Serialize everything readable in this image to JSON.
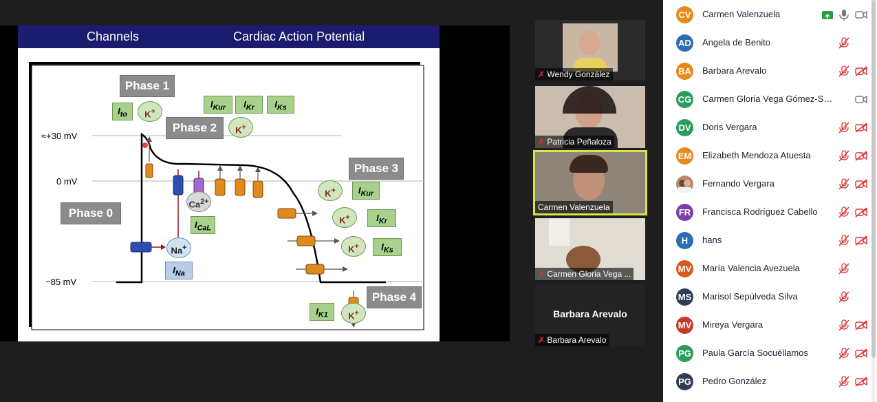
{
  "slide": {
    "header_left": "Channels",
    "header_right": "Cardiac Action Potential",
    "phases": [
      "Phase 0",
      "Phase 1",
      "Phase 2",
      "Phase 3",
      "Phase 4"
    ],
    "voltages": [
      "≈+30 mV",
      "0 mV",
      "−85 mV"
    ],
    "ion_k": "K",
    "ion_k_sup": "+",
    "ion_ca": "Ca",
    "ion_ca_sup": "2+",
    "ion_na": "Na",
    "ion_na_sup": "+",
    "cur_main": "I",
    "currents": {
      "ito": "to",
      "ikur": "Kur",
      "ikr": "Kr",
      "iks": "Ks",
      "ical": "CaL",
      "ina": "Na",
      "ik1": "K1"
    }
  },
  "videos": [
    {
      "name": "Wendy González",
      "muted": true
    },
    {
      "name": "Patricia Peñaloza",
      "muted": true
    },
    {
      "name": "Carmen Valenzuela",
      "muted": false,
      "active": true
    },
    {
      "name": "Carmen Gloria Vega ...",
      "muted": true
    },
    {
      "name": "Barbara Arevalo",
      "muted": true,
      "big_name": "Barbara Arevalo"
    }
  ],
  "participants": [
    {
      "initials": "CV",
      "name": "Carmen Valenzuela",
      "color": "#e8891c",
      "mic": "on",
      "video": "on",
      "share": true
    },
    {
      "initials": "AD",
      "name": "Angela de Benito",
      "color": "#2d6db5",
      "mic": "off",
      "video": "none"
    },
    {
      "initials": "BA",
      "name": "Barbara Arevalo",
      "color": "#e8891c",
      "mic": "off",
      "video": "off"
    },
    {
      "initials": "CG",
      "name": "Carmen Gloria Vega Gómez-SR...",
      "color": "#2a9d5c",
      "mic": "none",
      "video": "on"
    },
    {
      "initials": "DV",
      "name": "Doris Vergara",
      "color": "#2a9d5c",
      "mic": "off",
      "video": "off"
    },
    {
      "initials": "EM",
      "name": "Elizabeth Mendoza Atuesta",
      "color": "#e8891c",
      "mic": "off",
      "video": "off"
    },
    {
      "initials": "",
      "name": "Fernando Vergara",
      "color": "#b98a6e",
      "mic": "off",
      "video": "off",
      "photo": true
    },
    {
      "initials": "FR",
      "name": "Francisca Rodríguez Cabello",
      "color": "#7b3fa8",
      "mic": "off",
      "video": "off"
    },
    {
      "initials": "H",
      "name": "hans",
      "color": "#2d6db5",
      "mic": "off",
      "video": "off"
    },
    {
      "initials": "MV",
      "name": "María Valencia Avezuela",
      "color": "#d9581c",
      "mic": "off",
      "video": "none"
    },
    {
      "initials": "MS",
      "name": "Marisol Sepúlveda Silva",
      "color": "#2f3e55",
      "mic": "off",
      "video": "none"
    },
    {
      "initials": "MV",
      "name": "Mireya Vergara",
      "color": "#c43b2c",
      "mic": "off",
      "video": "off"
    },
    {
      "initials": "PG",
      "name": "Paula García Socuéllamos",
      "color": "#2a9d5c",
      "mic": "off",
      "video": "off"
    },
    {
      "initials": "PG",
      "name": "Pedro González",
      "color": "#2f3e55",
      "mic": "off",
      "video": "off"
    }
  ]
}
